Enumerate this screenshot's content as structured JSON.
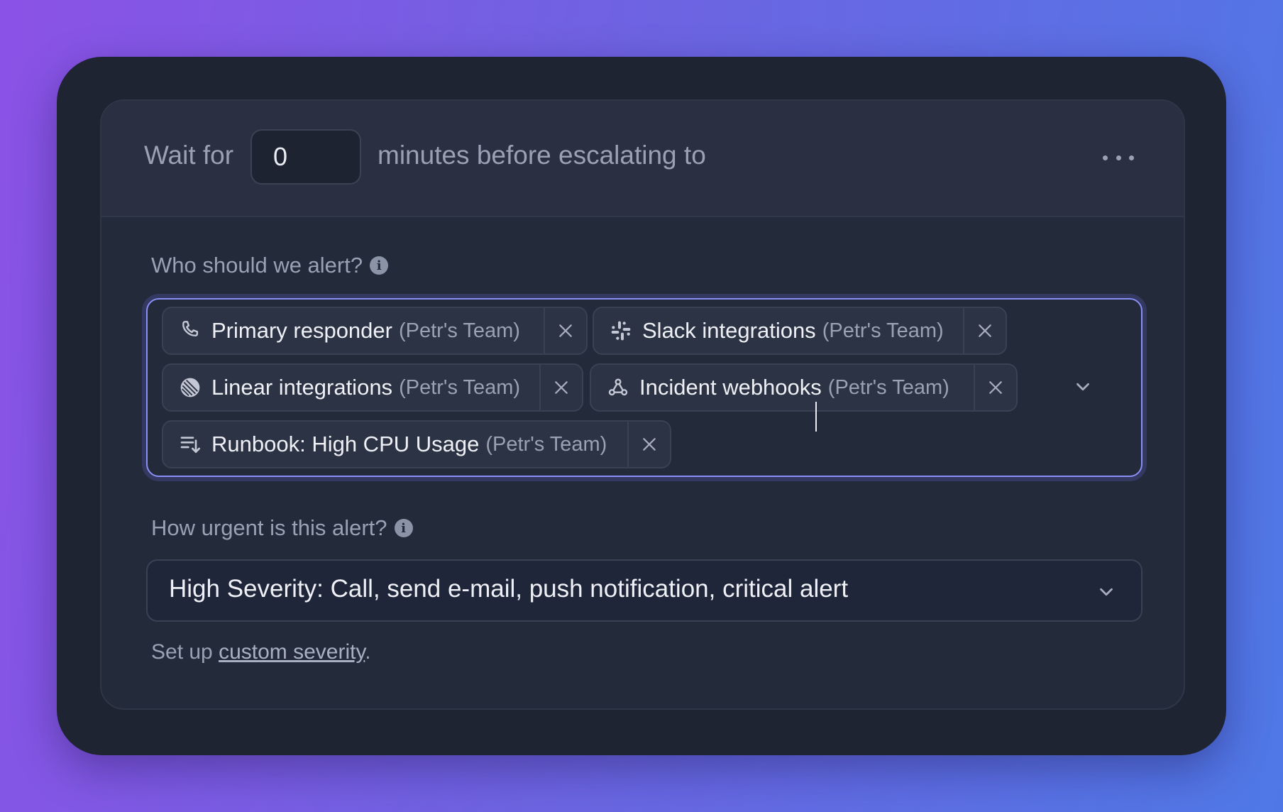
{
  "escalation": {
    "wait_prefix": "Wait for",
    "wait_value": "0",
    "wait_suffix": "minutes before escalating to",
    "more_icon": "more-horizontal-icon"
  },
  "alert_targets": {
    "label": "Who should we alert?",
    "chips": [
      {
        "name": "Primary responder",
        "team": "(Petr's Team)",
        "icon": "phone-icon"
      },
      {
        "name": "Slack integrations",
        "team": "(Petr's Team)",
        "icon": "slack-icon"
      },
      {
        "name": "Linear integrations",
        "team": "(Petr's Team)",
        "icon": "linear-icon"
      },
      {
        "name": "Incident webhooks",
        "team": "(Petr's Team)",
        "icon": "webhook-icon"
      },
      {
        "name": "Runbook: High CPU Usage",
        "team": "(Petr's Team)",
        "icon": "runbook-icon"
      }
    ]
  },
  "urgency": {
    "label": "How urgent is this alert?",
    "selected": "High Severity: Call, send e-mail, push notification, critical alert"
  },
  "footer": {
    "prefix": "Set up",
    "link_text": "custom severity",
    "suffix": "."
  },
  "colors": {
    "accent": "#8a8ff5",
    "card_bg": "#232a3a",
    "text_primary": "#eef0f5",
    "text_muted": "#9aa1b3"
  }
}
